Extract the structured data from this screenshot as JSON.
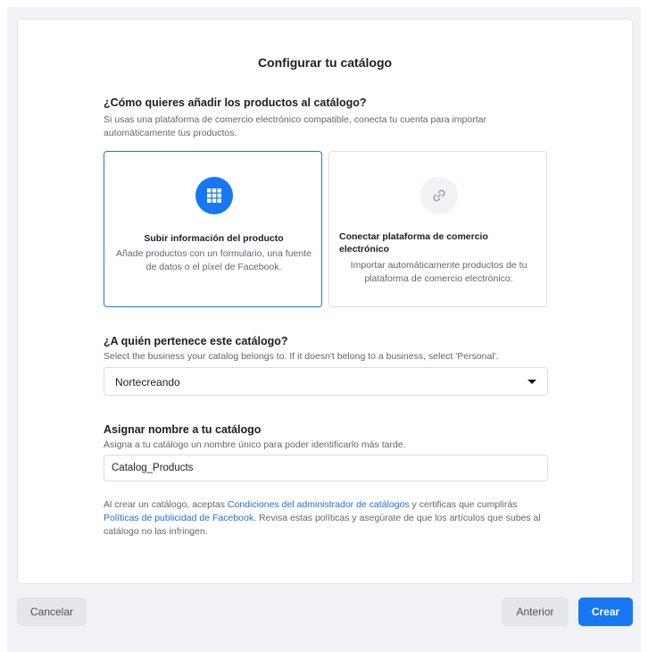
{
  "dialog": {
    "title": "Configurar tu catálogo"
  },
  "add_products": {
    "heading": "¿Cómo quieres añadir los productos al catálogo?",
    "description": "Si usas una plataforma de comercio electrónico compatible, conecta tu cuenta para importar automáticamente tus productos.",
    "options": [
      {
        "icon": "grid-icon",
        "title": "Subir información del producto",
        "description": "Añade productos con un formulario, una fuente de datos o el píxel de Facebook.",
        "selected": true
      },
      {
        "icon": "link-icon",
        "title": "Conectar plataforma de comercio electrónico",
        "description": "Importar automáticamente productos de tu plataforma de comercio electrónico.",
        "selected": false
      }
    ]
  },
  "owner": {
    "heading": "¿A quién pertenece este catálogo?",
    "description": "Select the business your catalog belongs to. If it doesn't belong to a business, select 'Personal'.",
    "selected_value": "Nortecreando"
  },
  "catalog_name": {
    "heading": "Asignar nombre a tu catálogo",
    "description": "Asigna a tu catálogo un nombre único para poder identificarlo más tarde.",
    "value": "Catalog_Products"
  },
  "terms": {
    "text_1": "Al crear un catálogo, aceptas ",
    "link_1": "Condiciones del administrador de catálogos",
    "text_2": " y certificas que cumplirás ",
    "link_2": "Políticas de publicidad de Facebook",
    "text_3": ". Revisa estas políticas y asegúrate de que los artículos que subes al catálogo no las infringen."
  },
  "footer": {
    "cancel_label": "Cancelar",
    "previous_label": "Anterior",
    "create_label": "Crear"
  },
  "colors": {
    "accent": "#1877f2",
    "link": "#216fdb",
    "secondary_button": "#e4e6eb"
  }
}
